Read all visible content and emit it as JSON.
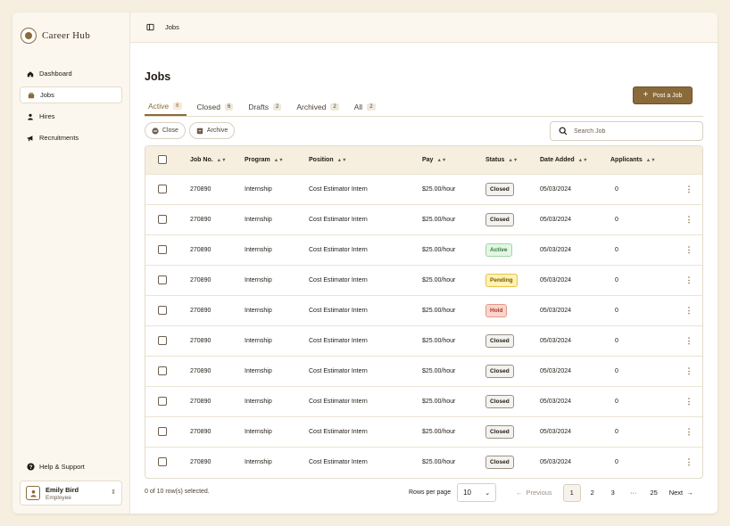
{
  "app": {
    "name": "Career Hub"
  },
  "sidebar": {
    "items": [
      {
        "label": "Dashboard",
        "icon": "home-icon"
      },
      {
        "label": "Jobs",
        "icon": "briefcase-icon",
        "active": true
      },
      {
        "label": "Hires",
        "icon": "person-icon"
      },
      {
        "label": "Recruitments",
        "icon": "megaphone-icon"
      }
    ],
    "help_label": "Help & Support",
    "user": {
      "name": "Emily Bird",
      "role": "Employee"
    }
  },
  "topbar": {
    "breadcrumb": "Jobs"
  },
  "page": {
    "title": "Jobs",
    "post_button": "Post a Job",
    "tabs": [
      {
        "label": "Active",
        "count": "6"
      },
      {
        "label": "Closed",
        "count": "6"
      },
      {
        "label": "Drafts",
        "count": "2"
      },
      {
        "label": "Archived",
        "count": "2"
      },
      {
        "label": "All",
        "count": "2"
      }
    ],
    "actions": {
      "close": "Close",
      "archive": "Archive"
    },
    "search": {
      "placeholder": "Search Job"
    }
  },
  "table": {
    "headers": [
      "Job No.",
      "Program",
      "Position",
      "Pay",
      "Status",
      "Date Added",
      "Applicants"
    ],
    "rows": [
      {
        "job_no": "270890",
        "program": "Internship",
        "position": "Cost Estimator Intern",
        "pay": "$25.00/hour",
        "status": "Closed",
        "date": "05/03/2024",
        "applicants": "0"
      },
      {
        "job_no": "270890",
        "program": "Internship",
        "position": "Cost Estimator Intern",
        "pay": "$25.00/hour",
        "status": "Closed",
        "date": "05/03/2024",
        "applicants": "0"
      },
      {
        "job_no": "270890",
        "program": "Internship",
        "position": "Cost Estimator Intern",
        "pay": "$25.00/hour",
        "status": "Active",
        "date": "05/03/2024",
        "applicants": "0"
      },
      {
        "job_no": "270890",
        "program": "Internship",
        "position": "Cost Estimator Intern",
        "pay": "$25.00/hour",
        "status": "Pending",
        "date": "05/03/2024",
        "applicants": "0"
      },
      {
        "job_no": "270890",
        "program": "Internship",
        "position": "Cost Estimator Intern",
        "pay": "$25.00/hour",
        "status": "Hold",
        "date": "05/03/2024",
        "applicants": "0"
      },
      {
        "job_no": "270890",
        "program": "Internship",
        "position": "Cost Estimator Intern",
        "pay": "$25.00/hour",
        "status": "Closed",
        "date": "05/03/2024",
        "applicants": "0"
      },
      {
        "job_no": "270890",
        "program": "Internship",
        "position": "Cost Estimator Intern",
        "pay": "$25.00/hour",
        "status": "Closed",
        "date": "05/03/2024",
        "applicants": "0"
      },
      {
        "job_no": "270890",
        "program": "Internship",
        "position": "Cost Estimator Intern",
        "pay": "$25.00/hour",
        "status": "Closed",
        "date": "05/03/2024",
        "applicants": "0"
      },
      {
        "job_no": "270890",
        "program": "Internship",
        "position": "Cost Estimator Intern",
        "pay": "$25.00/hour",
        "status": "Closed",
        "date": "05/03/2024",
        "applicants": "0"
      },
      {
        "job_no": "270890",
        "program": "Internship",
        "position": "Cost Estimator Intern",
        "pay": "$25.00/hour",
        "status": "Closed",
        "date": "05/03/2024",
        "applicants": "0"
      }
    ]
  },
  "footer": {
    "selected_text": "0 of 10 row(s) selected.",
    "rows_per_page_label": "Rows per page",
    "rows_per_page_value": "10",
    "previous": "Previous",
    "next": "Next",
    "pages": [
      "1",
      "2",
      "3",
      "···",
      "25"
    ],
    "current_page": "1"
  },
  "colors": {
    "accent": "#8a6a3a",
    "background": "#f6efe0"
  }
}
